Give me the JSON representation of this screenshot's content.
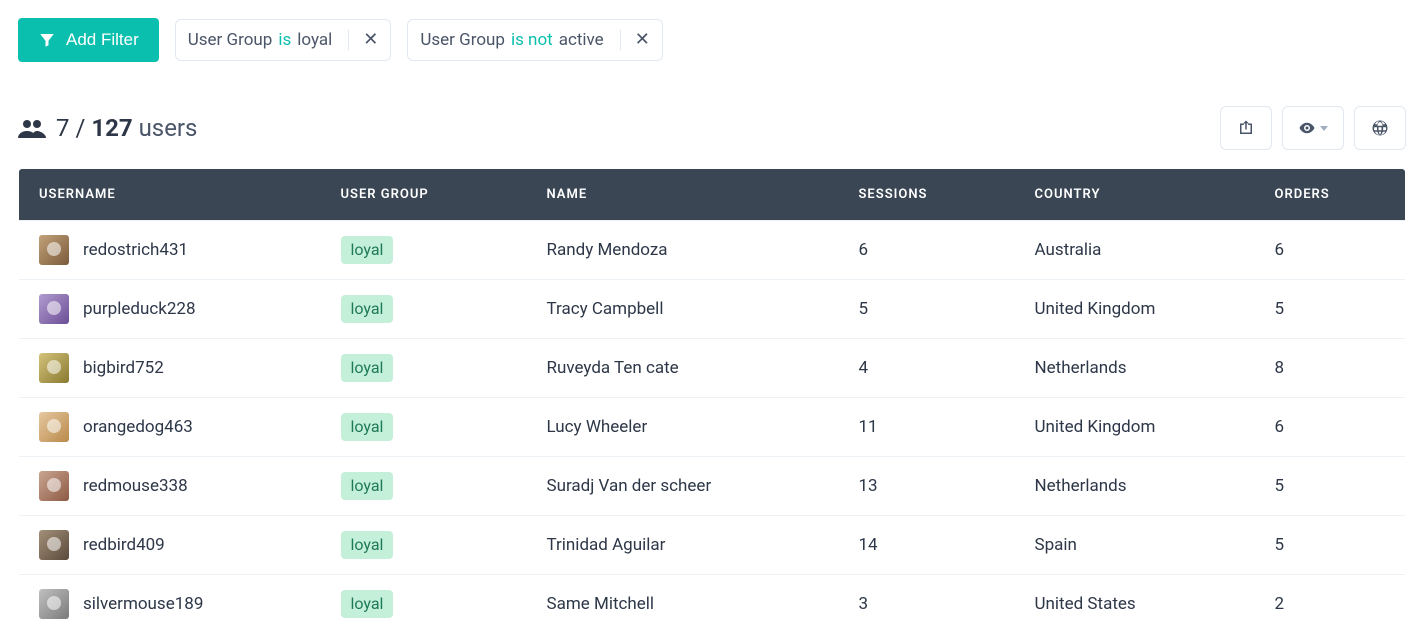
{
  "filter_bar": {
    "add_button_label": "Add Filter",
    "chips": [
      {
        "field": "User Group",
        "operator": "is",
        "value": "loyal"
      },
      {
        "field": "User Group",
        "operator": "is not",
        "value": "active"
      }
    ]
  },
  "summary": {
    "shown": "7",
    "separator": "/",
    "total": "127",
    "label": "users"
  },
  "columns": {
    "username": "USERNAME",
    "user_group": "USER GROUP",
    "name": "NAME",
    "sessions": "SESSIONS",
    "country": "COUNTRY",
    "orders": "ORDERS"
  },
  "rows": [
    {
      "username": "redostrich431",
      "group": "loyal",
      "name": "Randy Mendoza",
      "sessions": "6",
      "country": "Australia",
      "orders": "6",
      "avatar_bg": "linear-gradient(135deg,#c2a17a,#7a5a3a)"
    },
    {
      "username": "purpleduck228",
      "group": "loyal",
      "name": "Tracy Campbell",
      "sessions": "5",
      "country": "United Kingdom",
      "orders": "5",
      "avatar_bg": "linear-gradient(135deg,#b29bcf,#6a4e96)"
    },
    {
      "username": "bigbird752",
      "group": "loyal",
      "name": "Ruveyda Ten cate",
      "sessions": "4",
      "country": "Netherlands",
      "orders": "8",
      "avatar_bg": "linear-gradient(135deg,#d3c27a,#8a7a30)"
    },
    {
      "username": "orangedog463",
      "group": "loyal",
      "name": "Lucy Wheeler",
      "sessions": "11",
      "country": "United Kingdom",
      "orders": "6",
      "avatar_bg": "linear-gradient(135deg,#e6c7a0,#b98a4a)"
    },
    {
      "username": "redmouse338",
      "group": "loyal",
      "name": "Suradj Van der scheer",
      "sessions": "13",
      "country": "Netherlands",
      "orders": "5",
      "avatar_bg": "linear-gradient(135deg,#caa590,#8c5a44)"
    },
    {
      "username": "redbird409",
      "group": "loyal",
      "name": "Trinidad Aguilar",
      "sessions": "14",
      "country": "Spain",
      "orders": "5",
      "avatar_bg": "linear-gradient(135deg,#a3907a,#5a4a3a)"
    },
    {
      "username": "silvermouse189",
      "group": "loyal",
      "name": "Same Mitchell",
      "sessions": "3",
      "country": "United States",
      "orders": "2",
      "avatar_bg": "linear-gradient(135deg,#c0c0c0,#7a7a7a)"
    }
  ]
}
